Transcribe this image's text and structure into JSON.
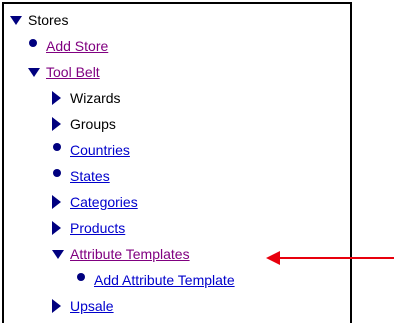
{
  "tree": {
    "root": {
      "label": "Stores",
      "state": "expanded"
    },
    "add_store": {
      "label": "Add Store"
    },
    "tool_belt": {
      "label": "Tool Belt",
      "state": "expanded"
    },
    "wizards": {
      "label": "Wizards"
    },
    "groups": {
      "label": "Groups"
    },
    "countries": {
      "label": "Countries"
    },
    "states": {
      "label": "States"
    },
    "categories": {
      "label": "Categories"
    },
    "products": {
      "label": "Products"
    },
    "attribute_templates": {
      "label": "Attribute Templates",
      "state": "expanded"
    },
    "add_attribute_template": {
      "label": "Add Attribute Template"
    },
    "upsale": {
      "label": "Upsale"
    }
  },
  "icons": {
    "expanded": "triangle-down-icon",
    "collapsed": "triangle-right-icon",
    "leaf": "bullet-icon"
  },
  "colors": {
    "icon": "#00007f",
    "visited_link": "#800080",
    "link": "#0000cc",
    "annotation_arrow": "#e8000d"
  }
}
